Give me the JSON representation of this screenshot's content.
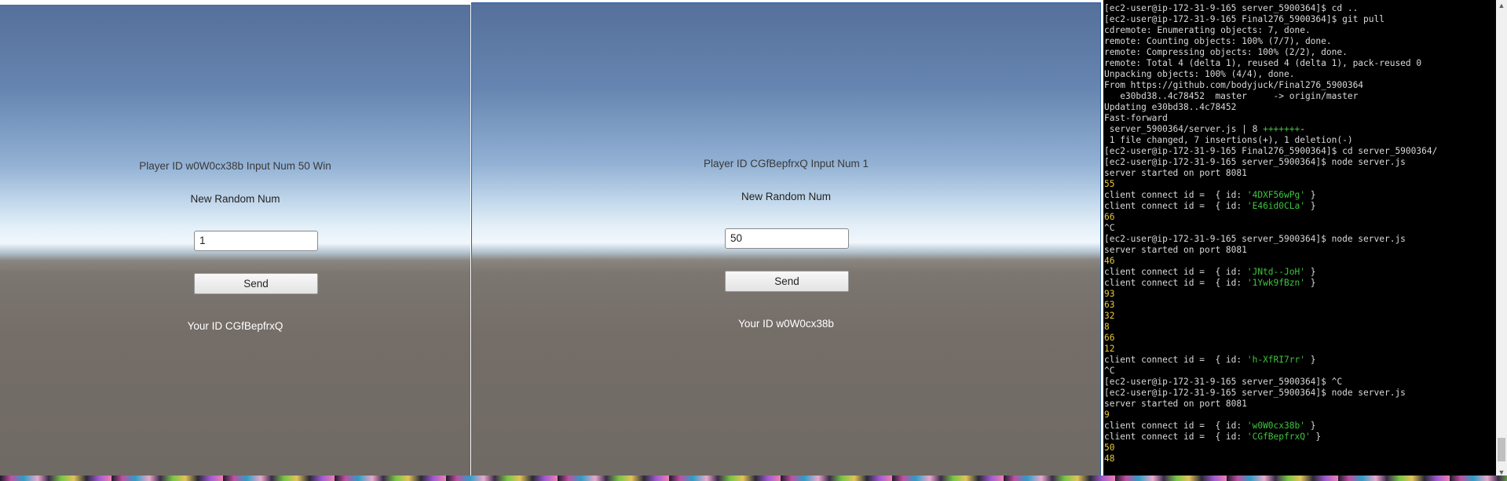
{
  "left_game": {
    "title": "Player ID w0W0cx38b Input Num 50 Win",
    "subtitle": "New Random Num",
    "input_value": "1",
    "send_label": "Send",
    "your_id": "Your ID CGfBepfrxQ"
  },
  "right_game": {
    "title": "Player ID CGfBepfrxQ Input Num 1",
    "subtitle": "New Random Num",
    "input_value": "50",
    "send_label": "Send",
    "your_id": "Your ID w0W0cx38b"
  },
  "terminal": {
    "colors": {
      "background": "#000000",
      "text": "#d9d9d9",
      "green": "#3fc33f",
      "yellow": "#e8c83a"
    },
    "lines": [
      {
        "segments": [
          {
            "t": "[ec2-user@ip-172-31-9-165 server_5900364]$ cd ..",
            "c": "gray"
          }
        ]
      },
      {
        "segments": [
          {
            "t": "[ec2-user@ip-172-31-9-165 Final276_5900364]$ git pull",
            "c": "gray"
          }
        ]
      },
      {
        "segments": [
          {
            "t": "cdremote: Enumerating objects: 7, done.",
            "c": "gray"
          }
        ]
      },
      {
        "segments": [
          {
            "t": "remote: Counting objects: 100% (7/7), done.",
            "c": "gray"
          }
        ]
      },
      {
        "segments": [
          {
            "t": "remote: Compressing objects: 100% (2/2), done.",
            "c": "gray"
          }
        ]
      },
      {
        "segments": [
          {
            "t": "remote: Total 4 (delta 1), reused 4 (delta 1), pack-reused 0",
            "c": "gray"
          }
        ]
      },
      {
        "segments": [
          {
            "t": "Unpacking objects: 100% (4/4), done.",
            "c": "gray"
          }
        ]
      },
      {
        "segments": [
          {
            "t": "From https://github.com/bodyjuck/Final276_5900364",
            "c": "gray"
          }
        ]
      },
      {
        "segments": [
          {
            "t": "   e30bd38..4c78452  master     -> origin/master",
            "c": "gray"
          }
        ]
      },
      {
        "segments": [
          {
            "t": "Updating e30bd38..4c78452",
            "c": "gray"
          }
        ]
      },
      {
        "segments": [
          {
            "t": "Fast-forward",
            "c": "gray"
          }
        ]
      },
      {
        "segments": [
          {
            "t": " server_5900364/server.js | 8 ",
            "c": "gray"
          },
          {
            "t": "+++++++",
            "c": "green"
          },
          {
            "t": "-",
            "c": "gray"
          }
        ]
      },
      {
        "segments": [
          {
            "t": " 1 file changed, 7 insertions(+), 1 deletion(-)",
            "c": "gray"
          }
        ]
      },
      {
        "segments": [
          {
            "t": "[ec2-user@ip-172-31-9-165 Final276_5900364]$ cd server_5900364/",
            "c": "gray"
          }
        ]
      },
      {
        "segments": [
          {
            "t": "[ec2-user@ip-172-31-9-165 server_5900364]$ node server.js",
            "c": "gray"
          }
        ]
      },
      {
        "segments": [
          {
            "t": "server started on port 8081",
            "c": "gray"
          }
        ]
      },
      {
        "segments": [
          {
            "t": "55",
            "c": "yellow"
          }
        ]
      },
      {
        "segments": [
          {
            "t": "client connect id =  { id: ",
            "c": "gray"
          },
          {
            "t": "'4DXF56wPg'",
            "c": "green"
          },
          {
            "t": " }",
            "c": "gray"
          }
        ]
      },
      {
        "segments": [
          {
            "t": "client connect id =  { id: ",
            "c": "gray"
          },
          {
            "t": "'E46id0CLa'",
            "c": "green"
          },
          {
            "t": " }",
            "c": "gray"
          }
        ]
      },
      {
        "segments": [
          {
            "t": "66",
            "c": "yellow"
          }
        ]
      },
      {
        "segments": [
          {
            "t": "^C",
            "c": "gray"
          }
        ]
      },
      {
        "segments": [
          {
            "t": "[ec2-user@ip-172-31-9-165 server_5900364]$ node server.js",
            "c": "gray"
          }
        ]
      },
      {
        "segments": [
          {
            "t": "server started on port 8081",
            "c": "gray"
          }
        ]
      },
      {
        "segments": [
          {
            "t": "46",
            "c": "yellow"
          }
        ]
      },
      {
        "segments": [
          {
            "t": "client connect id =  { id: ",
            "c": "gray"
          },
          {
            "t": "'JNtd--JoH'",
            "c": "green"
          },
          {
            "t": " }",
            "c": "gray"
          }
        ]
      },
      {
        "segments": [
          {
            "t": "client connect id =  { id: ",
            "c": "gray"
          },
          {
            "t": "'1Ywk9fBzn'",
            "c": "green"
          },
          {
            "t": " }",
            "c": "gray"
          }
        ]
      },
      {
        "segments": [
          {
            "t": "93",
            "c": "yellow"
          }
        ]
      },
      {
        "segments": [
          {
            "t": "63",
            "c": "yellow"
          }
        ]
      },
      {
        "segments": [
          {
            "t": "32",
            "c": "yellow"
          }
        ]
      },
      {
        "segments": [
          {
            "t": "8",
            "c": "yellow"
          }
        ]
      },
      {
        "segments": [
          {
            "t": "66",
            "c": "yellow"
          }
        ]
      },
      {
        "segments": [
          {
            "t": "12",
            "c": "yellow"
          }
        ]
      },
      {
        "segments": [
          {
            "t": "client connect id =  { id: ",
            "c": "gray"
          },
          {
            "t": "'h-XfRI7rr'",
            "c": "green"
          },
          {
            "t": " }",
            "c": "gray"
          }
        ]
      },
      {
        "segments": [
          {
            "t": "^C",
            "c": "gray"
          }
        ]
      },
      {
        "segments": [
          {
            "t": "[ec2-user@ip-172-31-9-165 server_5900364]$ ^C",
            "c": "gray"
          }
        ]
      },
      {
        "segments": [
          {
            "t": "[ec2-user@ip-172-31-9-165 server_5900364]$ node server.js",
            "c": "gray"
          }
        ]
      },
      {
        "segments": [
          {
            "t": "server started on port 8081",
            "c": "gray"
          }
        ]
      },
      {
        "segments": [
          {
            "t": "9",
            "c": "yellow"
          }
        ]
      },
      {
        "segments": [
          {
            "t": "client connect id =  { id: ",
            "c": "gray"
          },
          {
            "t": "'w0W0cx38b'",
            "c": "green"
          },
          {
            "t": " }",
            "c": "gray"
          }
        ]
      },
      {
        "segments": [
          {
            "t": "client connect id =  { id: ",
            "c": "gray"
          },
          {
            "t": "'CGfBepfrxQ'",
            "c": "green"
          },
          {
            "t": " }",
            "c": "gray"
          }
        ]
      },
      {
        "segments": [
          {
            "t": "50",
            "c": "yellow"
          }
        ]
      },
      {
        "segments": [
          {
            "t": "48",
            "c": "yellow"
          }
        ]
      }
    ]
  },
  "icons": {
    "scroll_up": "scroll-up-arrow-icon",
    "scroll_down": "scroll-down-arrow-icon"
  }
}
